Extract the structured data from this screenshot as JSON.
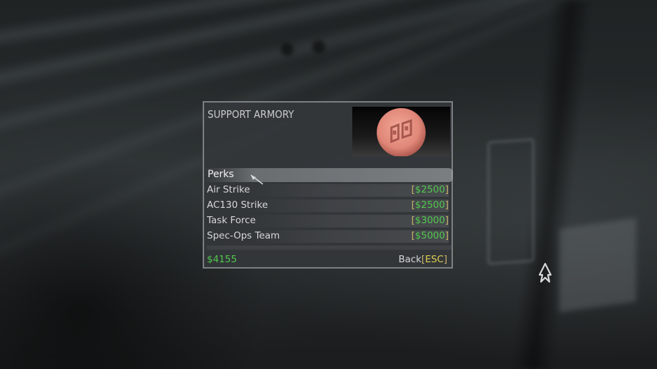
{
  "menu": {
    "title": "SUPPORT ARMORY",
    "category_label": "Perks",
    "items": [
      {
        "name": "Air Strike",
        "price": "$2500"
      },
      {
        "name": "AC130 Strike",
        "price": "$2500"
      },
      {
        "name": "Task Force",
        "price": "$3000"
      },
      {
        "name": "Spec-Ops Team",
        "price": "$5000"
      }
    ],
    "funds": "$4155",
    "back_label": "Back",
    "back_key": "ESC",
    "bracket_open": "[",
    "bracket_close": "]"
  },
  "icons": {
    "preview": "red-dogtag-emblem-icon",
    "cursor": "arrow-cursor-icon",
    "crosshair": "crosshair-icon"
  },
  "colors": {
    "price_green": "#52c84e",
    "esc_yellow": "#e0cf52",
    "bracket": "#c8b46a",
    "emblem": "#e08778"
  }
}
